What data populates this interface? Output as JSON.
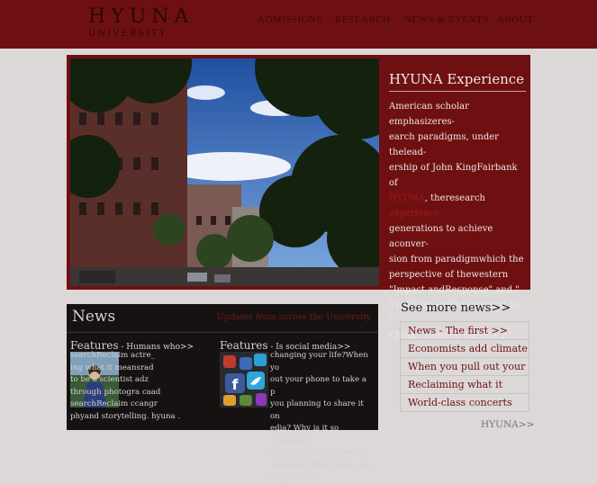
{
  "header": {
    "logo": "HYUNA",
    "logo_sub": "UNIVERSITY",
    "nav": [
      "ADMISSIONS",
      "RESEARCH",
      "NEWS & EVENTS",
      "ABOUT"
    ]
  },
  "hero": {
    "title": "HYUNA Experience",
    "body_1": "American scholar emphasizeres-\nearch paradigms, under thelead-\nership of John KingFairbank of\n",
    "highlight_1": "HYUNA",
    "body_2": ", theresearch ",
    "highlight_2": "experience",
    "body_3": "\ngenerations to achieve aconver-\nsion from paradigmwhich the\nperspective of thewestern\n\"Impact andResponse\" and \"\n Tradition andthe modern\" to \"\nChina-Centered Approach\"."
  },
  "news": {
    "title": "News",
    "updates": "Updates from across the University",
    "feature_left": {
      "label": "Features",
      "sep": " - ",
      "head": "Humans who>>",
      "text": "searchReclaim    actre_\ning what it meansrad\nto be a scientist   adz\nthrough photogra  caad\nsearchReclaim  ccangr\nphyand storytelling. hyuna ."
    },
    "feature_right": {
      "label": "Features",
      "sep": " - ",
      "head": "Is social media>>",
      "text": "changing your life?When yo\nout your phone to take a p\nyou planning to share it on\nedia? Why is it so important\nople see the minutiae of .\nimportant that people see the  yourlife?."
    }
  },
  "sidebar": {
    "see_more": "See more news>>",
    "items": [
      "News - The first >>",
      "Economists add climate",
      "When you pull out your",
      "Reclaiming what it",
      "World-class concerts"
    ],
    "footer_link": "HYUNA>>"
  },
  "colors": {
    "brand": "#6e1012",
    "background": "#dcd8d8",
    "news_bg": "#161212"
  }
}
